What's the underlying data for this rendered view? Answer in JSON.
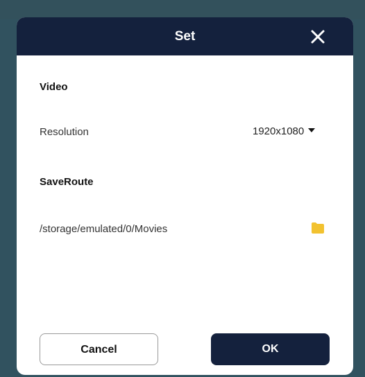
{
  "dialog": {
    "title": "Set"
  },
  "video": {
    "section_title": "Video",
    "resolution_label": "Resolution",
    "resolution_value": "1920x1080"
  },
  "save_route": {
    "section_title": "SaveRoute",
    "path": "/storage/emulated/0/Movies"
  },
  "buttons": {
    "cancel_label": "Cancel",
    "ok_label": "OK"
  },
  "icons": {
    "close": "close-icon",
    "folder": "folder-icon",
    "dropdown": "caret-down-icon"
  },
  "colors": {
    "header_bg": "#14213d",
    "backdrop": "#31525f",
    "folder": "#f2c230"
  }
}
